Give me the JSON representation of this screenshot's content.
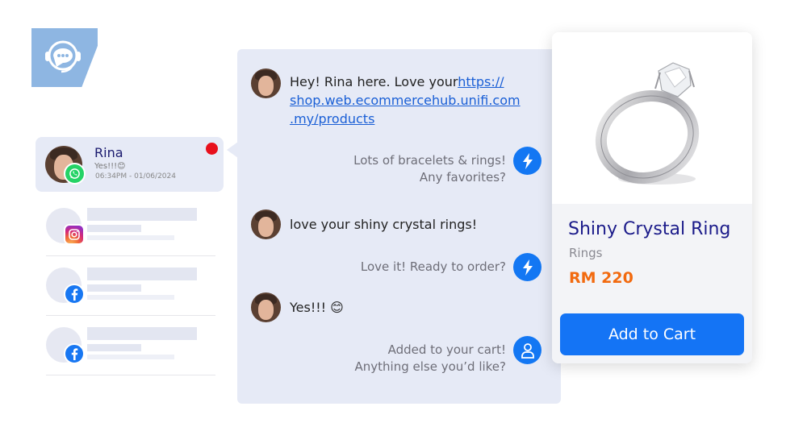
{
  "conversations": {
    "active": {
      "name": "Rina",
      "preview": "Yes!!!😊",
      "time": "06:34PM - 01/06/2024",
      "channel_icon": "whatsapp-icon",
      "unread": true
    },
    "others": [
      {
        "channel_icon": "instagram-icon"
      },
      {
        "channel_icon": "facebook-icon"
      },
      {
        "channel_icon": "facebook-icon"
      }
    ]
  },
  "chat": {
    "messages": [
      {
        "from": "customer",
        "text": "Hey! Rina here. Love your",
        "link": "https://shop.web.ecommercehub.unifi.com.my/products",
        "link_lines": [
          "https://",
          "shop.web.ecommercehub.unifi.com",
          ".my/products"
        ]
      },
      {
        "from": "bot",
        "lines": [
          "Lots of bracelets & rings!",
          "Any favorites?"
        ],
        "icon": "lightning-icon"
      },
      {
        "from": "customer",
        "text": "love your shiny crystal rings!"
      },
      {
        "from": "bot",
        "lines": [
          "Love it! Ready to order?"
        ],
        "icon": "lightning-icon"
      },
      {
        "from": "customer",
        "text": "Yes!!!  😊"
      },
      {
        "from": "agent",
        "lines": [
          "Added to your cart!",
          "Anything else you’d like?"
        ],
        "icon": "user-icon"
      }
    ]
  },
  "product": {
    "name": "Shiny Crystal Ring",
    "category": "Rings",
    "price": "RM 220",
    "button_label": "Add to Cart"
  },
  "colors": {
    "accent": "#1474f5",
    "price": "#f26a0f",
    "unread": "#e8101c",
    "panel": "#e6eaf6"
  }
}
